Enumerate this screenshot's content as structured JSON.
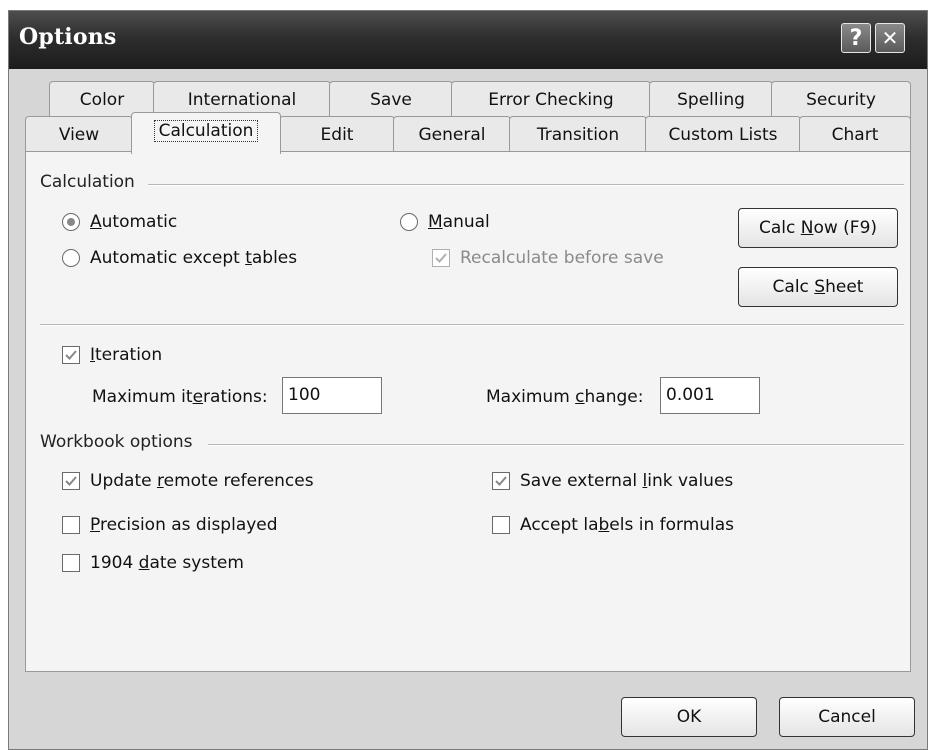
{
  "window": {
    "title": "Options",
    "help_glyph": "?",
    "close_glyph": "✕"
  },
  "tabs_row1": [
    {
      "label": "Color"
    },
    {
      "label": "International"
    },
    {
      "label": "Save"
    },
    {
      "label": "Error Checking"
    },
    {
      "label": "Spelling"
    },
    {
      "label": "Security"
    }
  ],
  "tabs_row2": [
    {
      "label": "View"
    },
    {
      "label": "Calculation",
      "active": true
    },
    {
      "label": "Edit"
    },
    {
      "label": "General"
    },
    {
      "label": "Transition"
    },
    {
      "label": "Custom Lists"
    },
    {
      "label": "Chart"
    }
  ],
  "calculation": {
    "group_title": "Calculation",
    "automatic": {
      "pre": "",
      "accel": "A",
      "post": "utomatic",
      "selected": true
    },
    "automatic_except_tables": {
      "pre": "Automatic except ",
      "accel": "t",
      "post": "ables",
      "selected": false
    },
    "manual": {
      "pre": "",
      "accel": "M",
      "post": "anual",
      "selected": false
    },
    "recalculate_before_save": {
      "label": "Recalculate before save",
      "checked": true,
      "enabled": false
    },
    "calc_now_button": {
      "pre": "Calc ",
      "accel": "N",
      "post": "ow (F9)"
    },
    "calc_sheet_button": {
      "pre": "Calc ",
      "accel": "S",
      "post": "heet"
    }
  },
  "iteration": {
    "checkbox": {
      "pre": "",
      "accel": "I",
      "post": "teration",
      "checked": true
    },
    "max_iterations": {
      "pre": "Maximum it",
      "accel": "e",
      "post": "rations:",
      "value": "100"
    },
    "max_change": {
      "pre": "Maximum ",
      "accel": "c",
      "post": "hange:",
      "value": "0.001"
    }
  },
  "workbook": {
    "group_title": "Workbook options",
    "update_remote": {
      "pre": "Update ",
      "accel": "r",
      "post": "emote references",
      "checked": true
    },
    "precision_as_displayed": {
      "pre": "",
      "accel": "P",
      "post": "recision as displayed",
      "checked": false
    },
    "date_system_1904": {
      "pre": "1904 ",
      "accel": "d",
      "post": "ate system",
      "checked": false
    },
    "save_external_links": {
      "pre": "Save external ",
      "accel": "l",
      "post": "ink values",
      "checked": true
    },
    "accept_labels": {
      "pre": "Accept la",
      "accel": "b",
      "post": "els in formulas",
      "checked": false
    }
  },
  "footer": {
    "ok_label": "OK",
    "cancel_label": "Cancel"
  },
  "colors": {
    "titlebar": "#2e2e2e",
    "dialog_bg": "#d6d6d6",
    "panel_bg": "#f4f4f4",
    "disabled_text": "#8a8a8a"
  }
}
